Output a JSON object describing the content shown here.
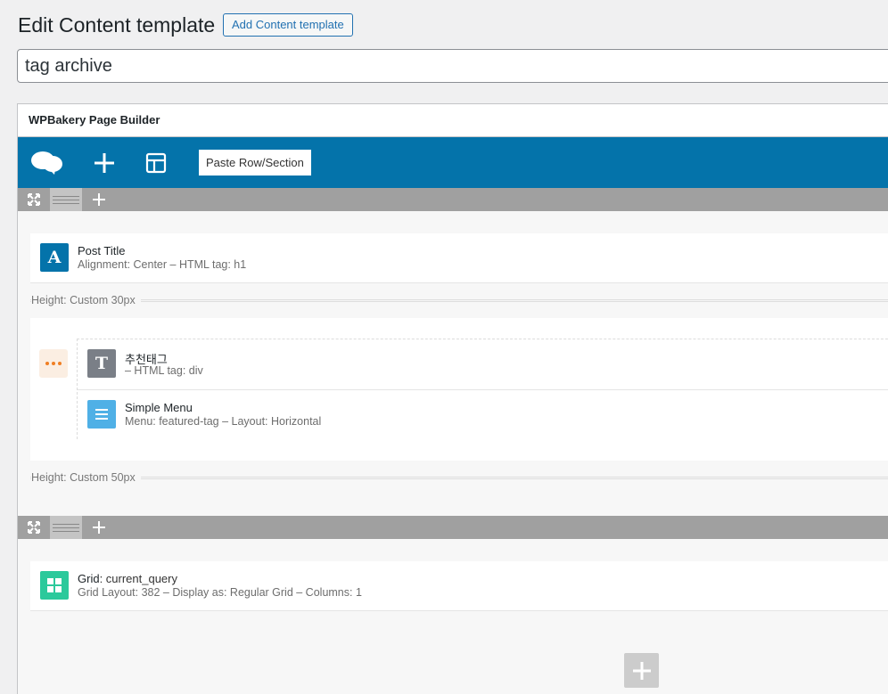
{
  "header": {
    "title": "Edit Content template",
    "add_button": "Add Content template"
  },
  "title_field": {
    "value": "tag archive"
  },
  "builder": {
    "box_title": "WPBakery Page Builder",
    "navbar": {
      "paste_label": "Paste Row/Section",
      "accent": "#0473aa"
    },
    "rows": [
      {
        "elements": [
          {
            "name": "Post Title",
            "params": "Alignment: Center  – HTML tag: h1",
            "icon": "post-title-icon",
            "icon_letter": "A",
            "icon_color": "#0473aa"
          }
        ],
        "separator1": "Height: Custom  30px",
        "inner": {
          "elements": [
            {
              "name": "추천태그",
              "params": "– HTML tag: div",
              "icon": "text-icon",
              "icon_letter": "T",
              "icon_color": "#7a7f87"
            },
            {
              "name": "Simple Menu",
              "params": "Menu: featured-tag  – Layout: Horizontal",
              "icon": "menu-icon",
              "icon_color": "#4fb0e6"
            }
          ]
        },
        "separator2": "Height: Custom  50px"
      },
      {
        "elements": [
          {
            "name": "Grid",
            "name_value": ": current_query",
            "params": "Grid Layout: 382  – Display as: Regular Grid  – Columns: 1",
            "icon": "grid-icon",
            "icon_color": "#2bc99b"
          }
        ]
      }
    ]
  }
}
